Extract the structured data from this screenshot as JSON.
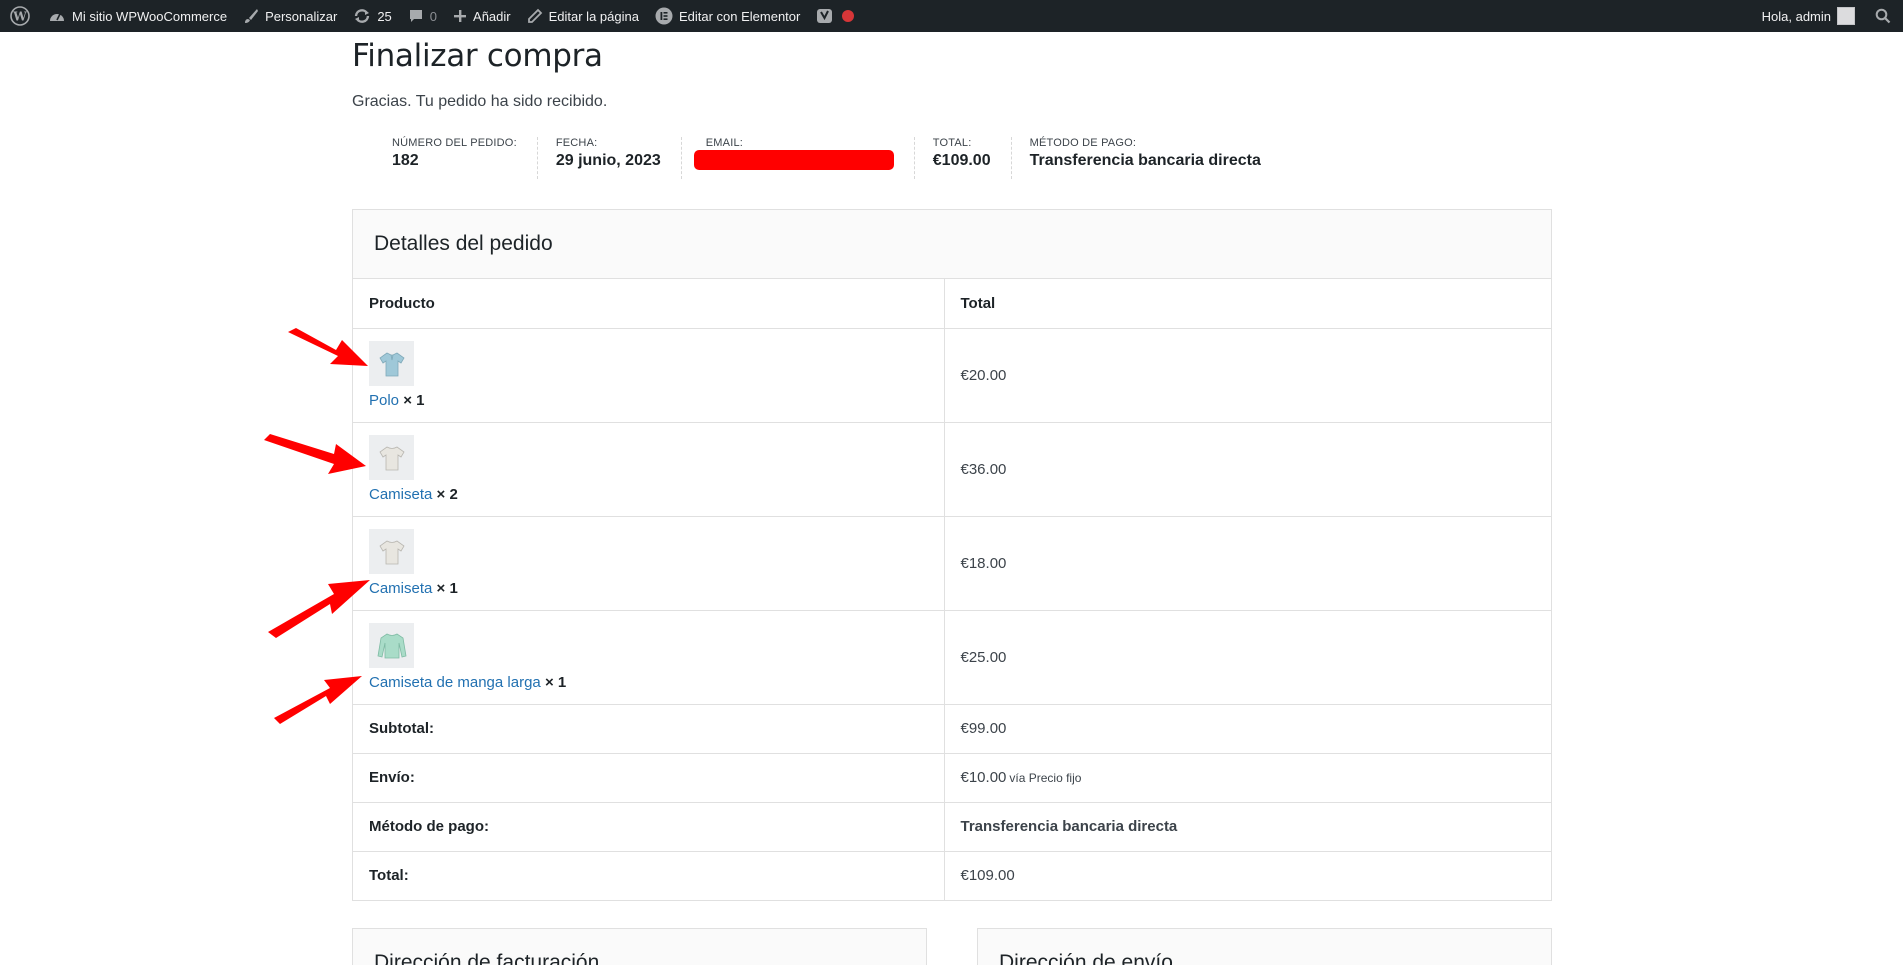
{
  "adminbar": {
    "site_name": "Mi sitio WPWooCommerce",
    "customize": "Personalizar",
    "updates_count": "25",
    "comments_count": "0",
    "add_new": "Añadir",
    "edit_page": "Editar la página",
    "edit_elementor": "Editar con Elementor",
    "greeting": "Hola, admin"
  },
  "page": {
    "title": "Finalizar compra",
    "thanks": "Gracias. Tu pedido ha sido recibido."
  },
  "overview": [
    {
      "label": "Número del pedido:",
      "value": "182"
    },
    {
      "label": "Fecha:",
      "value": "29 junio, 2023"
    },
    {
      "label": "Email:",
      "value": ""
    },
    {
      "label": "Total:",
      "value": "€109.00"
    },
    {
      "label": "Método de pago:",
      "value": "Transferencia bancaria directa"
    }
  ],
  "details": {
    "heading": "Detalles del pedido",
    "col_product": "Producto",
    "col_total": "Total",
    "items": [
      {
        "name": "Polo",
        "qty": "× 1",
        "total": "€20.00",
        "thumb_icon": "polo-shirt-icon"
      },
      {
        "name": "Camiseta",
        "qty": "× 2",
        "total": "€36.00",
        "thumb_icon": "tshirt-icon"
      },
      {
        "name": "Camiseta",
        "qty": "× 1",
        "total": "€18.00",
        "thumb_icon": "tshirt-icon"
      },
      {
        "name": "Camiseta de manga larga",
        "qty": "× 1",
        "total": "€25.00",
        "thumb_icon": "long-sleeve-shirt-icon"
      }
    ],
    "totals": [
      {
        "label": "Subtotal:",
        "value": "€99.00",
        "note": ""
      },
      {
        "label": "Envío:",
        "value": "€10.00",
        "note": "vía Precio fijo"
      },
      {
        "label": "Método de pago:",
        "value": "Transferencia bancaria directa",
        "note": ""
      },
      {
        "label": "Total:",
        "value": "€109.00",
        "note": ""
      }
    ]
  },
  "addresses": {
    "billing": "Dirección de facturación",
    "shipping": "Dirección de envío"
  },
  "colors": {
    "adminbar_bg": "#1d2327",
    "link": "#2271b1",
    "annotation_red": "#ff0000"
  }
}
